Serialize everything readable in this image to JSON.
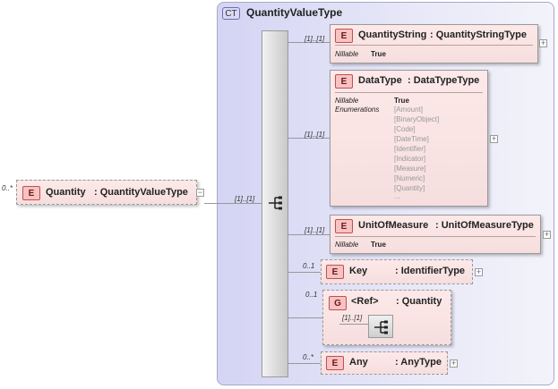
{
  "root": {
    "cardinality": "0..*",
    "badge": "E",
    "name": "Quantity",
    "type": ": QuantityValueType",
    "expander": "−"
  },
  "complex_type": {
    "badge": "CT",
    "name": "QuantityValueType",
    "sequence_cardinality": "[1]..[1]"
  },
  "children": {
    "quantity_string": {
      "cardinality": "[1]..[1]",
      "badge": "E",
      "name": "QuantityString",
      "type": ": QuantityStringType",
      "props": {
        "nillable_label": "Nillable",
        "nillable_value": "True"
      },
      "expander": "+"
    },
    "data_type": {
      "cardinality": "[1]..[1]",
      "badge": "E",
      "name": "DataType",
      "type": ": DataTypeType",
      "props": {
        "nillable_label": "Nillable",
        "nillable_value": "True",
        "enum_label": "Enumerations"
      },
      "enumerations": [
        "[Amount]",
        "[BinaryObject]",
        "[Code]",
        "[DateTime]",
        "[Identifier]",
        "[Indicator]",
        "[Measure]",
        "[Numeric]",
        "[Quantity]",
        "..."
      ],
      "expander": "+"
    },
    "unit_of_measure": {
      "cardinality": "[1]..[1]",
      "badge": "E",
      "name": "UnitOfMeasure",
      "type": ": UnitOfMeasureType",
      "props": {
        "nillable_label": "Nillable",
        "nillable_value": "True"
      },
      "expander": "+"
    },
    "key": {
      "cardinality": "0..1",
      "badge": "E",
      "name": "Key",
      "type": ": IdentifierType",
      "expander": "+"
    },
    "group_ref": {
      "cardinality": "0..1",
      "badge": "G",
      "name": "<Ref>",
      "type": ": Quantity",
      "inner_cardinality": "[1]..[1]"
    },
    "any": {
      "cardinality": "0..*",
      "badge": "E",
      "name": "Any",
      "type": ": AnyType",
      "expander": "+"
    }
  },
  "colors": {
    "element_fill": "#fde9e9",
    "complex_type_fill": "#e1e1f6",
    "badge_fill": "#f7c2c2"
  }
}
